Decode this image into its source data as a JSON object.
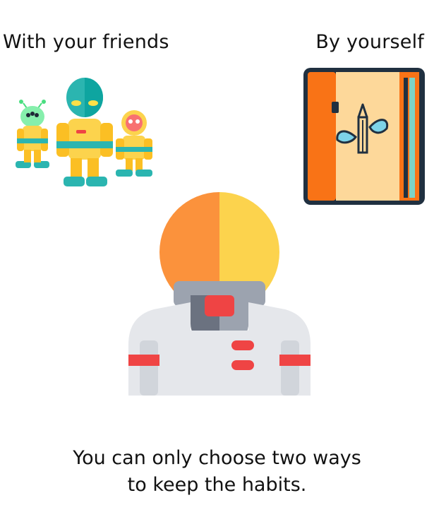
{
  "options": {
    "friends_label": "With your friends",
    "self_label": "By yourself"
  },
  "illustrations": {
    "friends": "alien-group-icon",
    "notebook": "notebook-pencil-icon",
    "astronaut": "astronaut-icon"
  },
  "caption": {
    "line1": "You can only choose two ways",
    "line2": "to keep the habits."
  },
  "colors": {
    "orange": "#fb923c",
    "yellow": "#fcd34d",
    "teal": "#2bb5b0",
    "navy": "#203040",
    "red": "#ef4444",
    "suit_gray": "#e5e7eb"
  }
}
